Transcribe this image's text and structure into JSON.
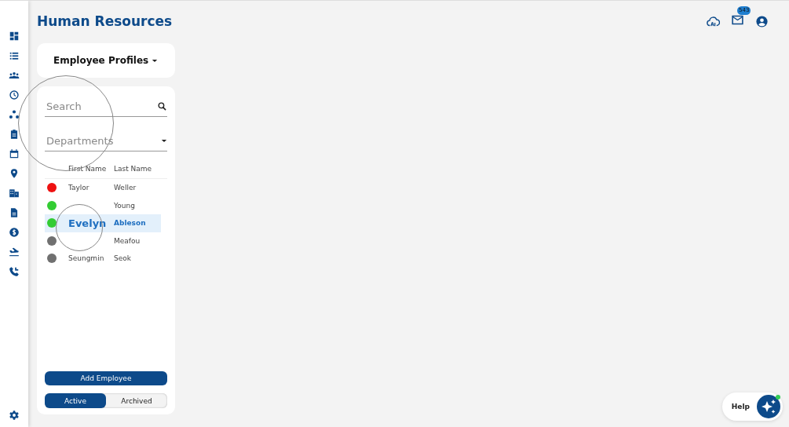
{
  "header": {
    "title": "Human Resources",
    "mail_badge": "543"
  },
  "profile_selector": {
    "value": "Employee Profiles"
  },
  "search": {
    "placeholder": "Search"
  },
  "department": {
    "placeholder": "Departments"
  },
  "table": {
    "columns": [
      "First Name",
      "Last Name"
    ],
    "rows": [
      {
        "first_name": "Taylor",
        "last_name": "Weller",
        "color": "#ee1111",
        "selected": false
      },
      {
        "first_name": "",
        "last_name": "Young",
        "color": "#33cc33",
        "selected": false
      },
      {
        "first_name": "Evelyn",
        "last_name": "Ableson",
        "color": "#33cc33",
        "selected": true
      },
      {
        "first_name": "",
        "last_name": "Meafou",
        "color": "#707070",
        "selected": false
      },
      {
        "first_name": "Seungmin",
        "last_name": "Seok",
        "color": "#707070",
        "selected": false
      }
    ]
  },
  "add_button": "Add Employee",
  "status_toggle": [
    {
      "label": "Active",
      "selected": true
    },
    {
      "label": "Archived",
      "selected": false
    }
  ],
  "help": {
    "label": "Help"
  }
}
